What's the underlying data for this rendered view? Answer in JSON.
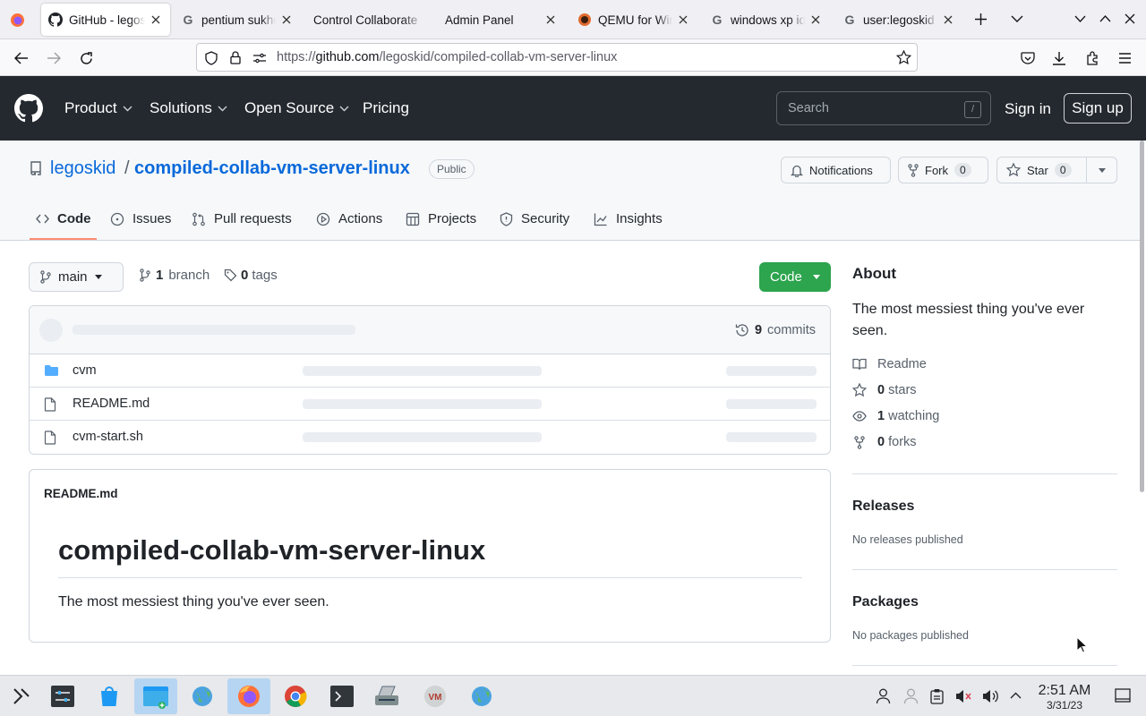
{
  "browser": {
    "tabs": [
      {
        "title": "GitHub - legoskid/compiled-collab-vm-server-linux",
        "icon": "github-icon",
        "active": true
      },
      {
        "title": "pentium sukhoi",
        "icon": "google-icon"
      },
      {
        "title": "Control Collaborate",
        "icon": "none"
      },
      {
        "title": "Admin Panel",
        "icon": "none"
      },
      {
        "title": "QEMU for Windows",
        "icon": "qemu-icon"
      },
      {
        "title": "windows xp id",
        "icon": "google-icon"
      },
      {
        "title": "user:legoskid",
        "icon": "google-icon"
      }
    ],
    "url_prefix": "https://",
    "url_domain": "github.com",
    "url_path": "/legoskid/compiled-collab-vm-server-linux"
  },
  "gh_header": {
    "nav": [
      "Product",
      "Solutions",
      "Open Source",
      "Pricing"
    ],
    "search_placeholder": "Search",
    "search_shortcut": "/",
    "sign_in": "Sign in",
    "sign_up": "Sign up"
  },
  "repo": {
    "owner": "legoskid",
    "separator": "/",
    "name": "compiled-collab-vm-server-linux",
    "visibility": "Public",
    "notifications_label": "Notifications",
    "fork_label": "Fork",
    "fork_count": "0",
    "star_label": "Star",
    "star_count": "0",
    "tabs": [
      "Code",
      "Issues",
      "Pull requests",
      "Actions",
      "Projects",
      "Security",
      "Insights"
    ]
  },
  "main": {
    "branch": "main",
    "branch_count": "1",
    "branch_word": "branch",
    "tag_count": "0",
    "tag_word": "tags",
    "code_button": "Code",
    "commit_count": "9",
    "commit_word": "commits",
    "files": [
      {
        "name": "cvm",
        "type": "folder"
      },
      {
        "name": "README.md",
        "type": "file"
      },
      {
        "name": "cvm-start.sh",
        "type": "file"
      }
    ],
    "readme": {
      "filename": "README.md",
      "title": "compiled-collab-vm-server-linux",
      "description": "The most messiest thing you've ever seen."
    }
  },
  "sidebar": {
    "about_heading": "About",
    "about_text": "The most messiest thing you've ever seen.",
    "readme_label": "Readme",
    "stars_count": "0",
    "stars_word": "stars",
    "watching_count": "1",
    "watching_word": "watching",
    "forks_count": "0",
    "forks_word": "forks",
    "releases_heading": "Releases",
    "releases_text": "No releases published",
    "packages_heading": "Packages",
    "packages_text": "No packages published"
  },
  "taskbar": {
    "time": "2:51 AM",
    "date": "3/31/23"
  },
  "colors": {
    "github_dark": "#24292f",
    "link_blue": "#0969da",
    "code_green": "#2da44e",
    "tab_accent": "#fd8c73"
  }
}
